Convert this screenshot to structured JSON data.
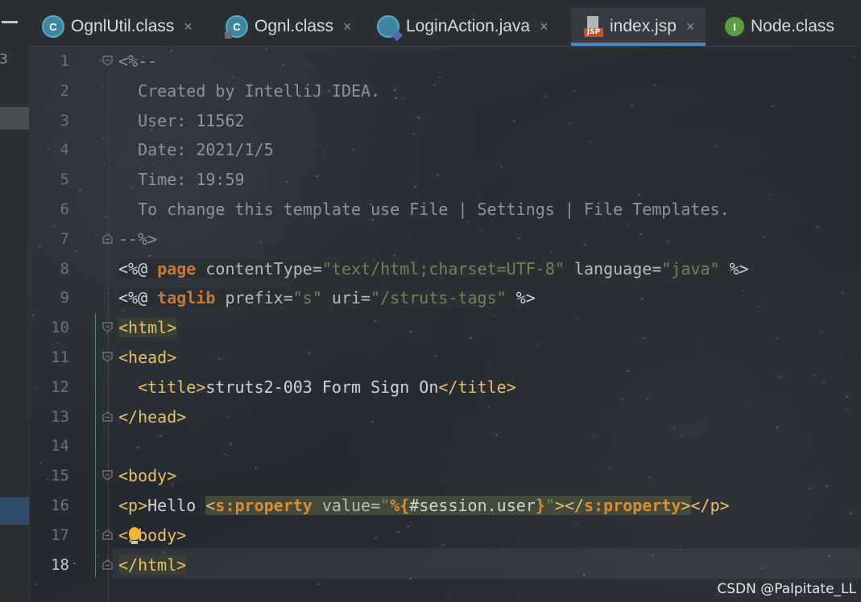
{
  "tabs": [
    {
      "label": "OgnlUtil.class",
      "icon": "class-c-icon",
      "active": false
    },
    {
      "label": "Ognl.class",
      "icon": "locked-class-icon",
      "active": false
    },
    {
      "label": "LoginAction.java",
      "icon": "java-class-icon",
      "active": false
    },
    {
      "label": "index.jsp",
      "icon": "jsp-file-icon",
      "active": true
    },
    {
      "label": "Node.class",
      "icon": "interface-icon",
      "active": false
    }
  ],
  "close_glyph": "×",
  "left_strip_digit": "3",
  "current_line": 18,
  "lines": [
    {
      "n": "1",
      "parts": [
        {
          "t": "<%--",
          "c": "cmt"
        }
      ]
    },
    {
      "n": "2",
      "parts": [
        {
          "t": "  Created by IntelliJ IDEA.",
          "c": "cmt"
        }
      ]
    },
    {
      "n": "3",
      "parts": [
        {
          "t": "  User: 11562",
          "c": "cmt"
        }
      ]
    },
    {
      "n": "4",
      "parts": [
        {
          "t": "  Date: 2021/1/5",
          "c": "cmt"
        }
      ]
    },
    {
      "n": "5",
      "parts": [
        {
          "t": "  Time: 19:59",
          "c": "cmt"
        }
      ]
    },
    {
      "n": "6",
      "parts": [
        {
          "t": "  To change this template use File | Settings | File Templates.",
          "c": "cmt"
        }
      ]
    },
    {
      "n": "7",
      "parts": [
        {
          "t": "--%>",
          "c": "cmt"
        }
      ]
    },
    {
      "n": "8",
      "parts": [
        {
          "t": "<%@ ",
          "c": "txt dir"
        },
        {
          "t": "page",
          "c": "kw dir"
        },
        {
          "t": " contentType=",
          "c": "attr dir"
        },
        {
          "t": "\"text/html;charset=UTF-8\"",
          "c": "str dir"
        },
        {
          "t": " language=",
          "c": "attr dir"
        },
        {
          "t": "\"java\"",
          "c": "str dir"
        },
        {
          "t": " %>",
          "c": "txt dir"
        }
      ]
    },
    {
      "n": "9",
      "parts": [
        {
          "t": "<%@ ",
          "c": "txt dir"
        },
        {
          "t": "taglib",
          "c": "kw dir"
        },
        {
          "t": " prefix=",
          "c": "attr dir"
        },
        {
          "t": "\"s\"",
          "c": "str dir"
        },
        {
          "t": " uri=",
          "c": "attr dir"
        },
        {
          "t": "\"/struts-tags\"",
          "c": "str dir"
        },
        {
          "t": " %>",
          "c": "txt dir"
        }
      ]
    },
    {
      "n": "10",
      "parts": [
        {
          "t": "<html>",
          "c": "tag hl-tag"
        }
      ]
    },
    {
      "n": "11",
      "parts": [
        {
          "t": "<head>",
          "c": "tag"
        }
      ]
    },
    {
      "n": "12",
      "parts": [
        {
          "t": "  <title>",
          "c": "tag"
        },
        {
          "t": "struts2-003 Form Sign On",
          "c": "txt"
        },
        {
          "t": "</title>",
          "c": "tag"
        }
      ]
    },
    {
      "n": "13",
      "parts": [
        {
          "t": "</head>",
          "c": "tag"
        }
      ]
    },
    {
      "n": "14",
      "parts": [
        {
          "t": "",
          "c": "txt"
        }
      ]
    },
    {
      "n": "15",
      "parts": [
        {
          "t": "<body>",
          "c": "tag"
        }
      ]
    },
    {
      "n": "16",
      "parts": [
        {
          "t": "<p>",
          "c": "tag"
        },
        {
          "t": "Hello ",
          "c": "txt"
        },
        {
          "t": "<",
          "c": "tag inj"
        },
        {
          "t": "s:property",
          "c": "sq inj"
        },
        {
          "t": " value=",
          "c": "attr inj"
        },
        {
          "t": "\"",
          "c": "str inj"
        },
        {
          "t": "%{",
          "c": "sq inj"
        },
        {
          "t": "#session.user",
          "c": "txt inj"
        },
        {
          "t": "}",
          "c": "sq inj"
        },
        {
          "t": "\"",
          "c": "str inj"
        },
        {
          "t": "></",
          "c": "tag inj"
        },
        {
          "t": "s:property",
          "c": "sq inj"
        },
        {
          "t": ">",
          "c": "tag inj"
        },
        {
          "t": "</p>",
          "c": "tag"
        }
      ]
    },
    {
      "n": "17",
      "parts": [
        {
          "t": "</body>",
          "c": "tag"
        }
      ]
    },
    {
      "n": "18",
      "parts": [
        {
          "t": "</html>",
          "c": "tag hl-tag"
        }
      ]
    }
  ],
  "watermark": "CSDN @Palpitate_LL"
}
